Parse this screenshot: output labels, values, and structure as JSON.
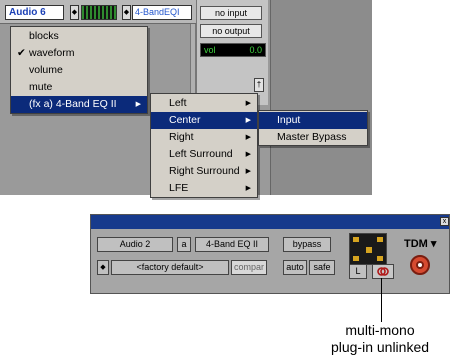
{
  "colors": {
    "menu_highlight": "#0b2a7a",
    "track_name": "#1a3fb5",
    "vol_text": "#3fd43f",
    "plugin_titlebar": "#173a8c",
    "link_corner": "#d6a420"
  },
  "track": {
    "name": "Audio 6",
    "name_arrow": "◆",
    "insert_arrow": "◆",
    "insert_label": "4-BandEQI"
  },
  "io": {
    "input": "no input",
    "output": "no output",
    "vol_label": "vol",
    "vol_value": "0.0",
    "small_button": "†"
  },
  "menu_view": {
    "items": [
      {
        "label": "blocks",
        "checked": false
      },
      {
        "label": "waveform",
        "checked": true
      },
      {
        "label": "volume",
        "checked": false
      },
      {
        "label": "mute",
        "checked": false
      },
      {
        "label": "(fx a) 4-Band EQ II",
        "selected": true
      }
    ],
    "check_mark": "✔",
    "arrow": "▶"
  },
  "menu_channels": {
    "items": [
      "Left",
      "Center",
      "Right",
      "Left Surround",
      "Right Surround",
      "LFE"
    ],
    "selected": "Center",
    "arrow": "▶"
  },
  "menu_params": {
    "items": [
      "Input",
      "Master Bypass"
    ],
    "selected": "Input"
  },
  "plugin": {
    "track": "Audio 2",
    "insert_letter": "a",
    "plugin_name": "4-Band EQ II",
    "bypass": "bypass",
    "preset_arrow": "◆",
    "preset": "<factory default>",
    "compare": "compar",
    "auto": "auto",
    "safe": "safe",
    "channel": "L",
    "tdm": "TDM ▾",
    "close": "x"
  },
  "callout": {
    "line1": "multi-mono",
    "line2": "plug-in unlinked"
  }
}
